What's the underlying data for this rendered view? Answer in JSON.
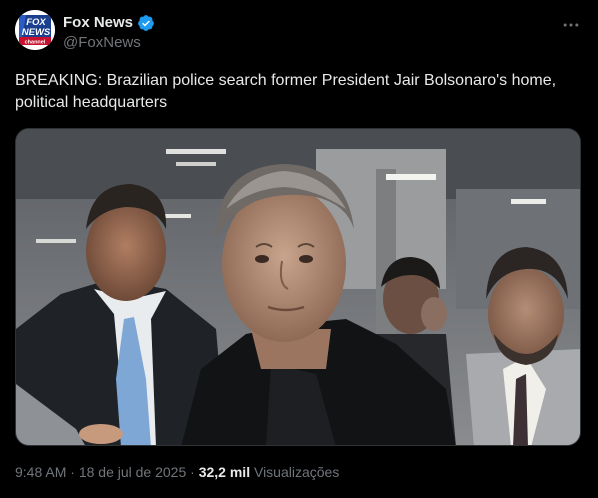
{
  "author": {
    "name": "Fox News",
    "handle": "@FoxNews",
    "verified": true,
    "avatar_logo_lines": [
      "FOX",
      "NEWS",
      "channel"
    ]
  },
  "post": {
    "text": "BREAKING: Brazilian police search former President Jair Bolsonaro's home, political headquarters",
    "media_alt": "Photo"
  },
  "meta": {
    "time": "9:48 AM",
    "separator": "·",
    "date": "18 de jul de 2025",
    "views_count": "32,2 mil",
    "views_label": "Visualizações"
  },
  "icons": {
    "more": "more-options-icon",
    "verified": "verified-badge-icon"
  },
  "colors": {
    "background": "#000000",
    "text_primary": "#e7e9ea",
    "text_secondary": "#71767b",
    "verified_blue": "#1d9bf0",
    "fox_blue": "#1a3f8f",
    "fox_red": "#c8102e"
  }
}
